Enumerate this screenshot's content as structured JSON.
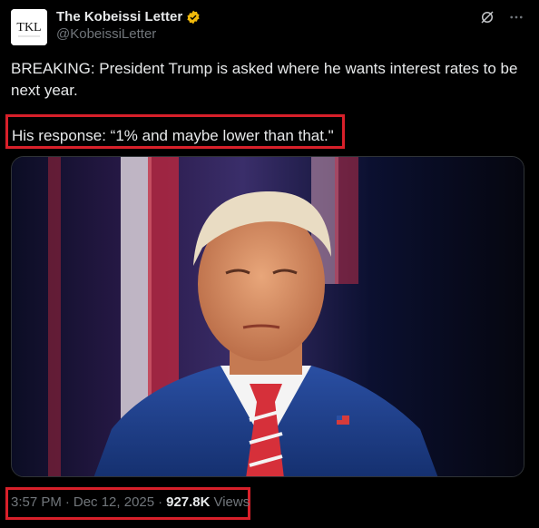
{
  "author": {
    "avatar_text": "TKL",
    "display_name": "The Kobeissi Letter",
    "handle": "@KobeissiLetter"
  },
  "icons": {
    "verified": "verified-badge-icon",
    "grok": "grok-icon",
    "more": "more-icon"
  },
  "tweet": {
    "text": "BREAKING: President Trump is asked where he wants interest rates to be next year.",
    "response": "His response: “1% and maybe lower than that.\""
  },
  "meta": {
    "time": "3:57 PM",
    "sep1": "·",
    "date": "Dec 12, 2025",
    "sep2": "·",
    "views_count": "927.8K",
    "views_label": "Views"
  },
  "colors": {
    "highlight": "#d8202a",
    "verified": "#f0b90b",
    "muted": "#71767b"
  }
}
